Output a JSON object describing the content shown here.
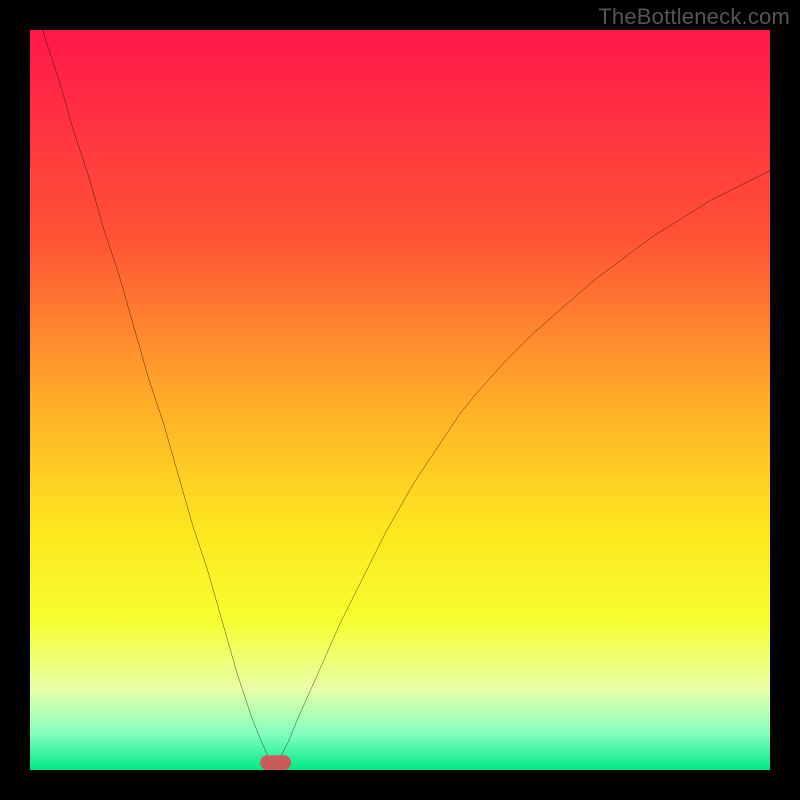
{
  "watermark": "TheBottleneck.com",
  "chart_data": {
    "type": "line",
    "title": "",
    "xlabel": "",
    "ylabel": "",
    "xlim": [
      0,
      100
    ],
    "ylim": [
      0,
      100
    ],
    "grid": false,
    "gradient_stops": [
      {
        "offset": 0.0,
        "color": "#ff174a"
      },
      {
        "offset": 0.28,
        "color": "#ff5335"
      },
      {
        "offset": 0.52,
        "color": "#ffb327"
      },
      {
        "offset": 0.68,
        "color": "#fde81f"
      },
      {
        "offset": 0.8,
        "color": "#f6ff32"
      },
      {
        "offset": 0.89,
        "color": "#e8ffa7"
      },
      {
        "offset": 0.95,
        "color": "#86ffc0"
      },
      {
        "offset": 1.0,
        "color": "#00e986"
      }
    ],
    "series": [
      {
        "name": "bottleneck-curve",
        "description": "Absolute-value style curve; minimum (zero bottleneck) near x≈33.",
        "x": [
          0,
          2,
          4,
          6,
          8,
          10,
          12,
          14,
          16,
          18,
          20,
          22,
          24,
          26,
          28,
          30,
          31,
          32,
          33,
          34,
          35,
          36,
          38,
          40,
          42,
          44,
          46,
          48,
          50,
          52,
          54,
          56,
          58,
          60,
          64,
          68,
          72,
          76,
          80,
          84,
          88,
          92,
          96,
          100
        ],
        "values": [
          106,
          99,
          93,
          86,
          80,
          73,
          67,
          60,
          53,
          47,
          40,
          33,
          27,
          20,
          13,
          7,
          4.5,
          2.2,
          0.5,
          2,
          4,
          6.5,
          11,
          15.5,
          20,
          24,
          28,
          32,
          35.5,
          39,
          42,
          45,
          48,
          50.5,
          55,
          59,
          62.5,
          66,
          69,
          72,
          74.5,
          77,
          79,
          81
        ]
      }
    ],
    "marker": {
      "name": "optimal-point",
      "shape": "rounded-rect",
      "x": 33.2,
      "y": 1.0,
      "width": 4.2,
      "height": 2.0,
      "color": "#cb5a5a"
    }
  }
}
